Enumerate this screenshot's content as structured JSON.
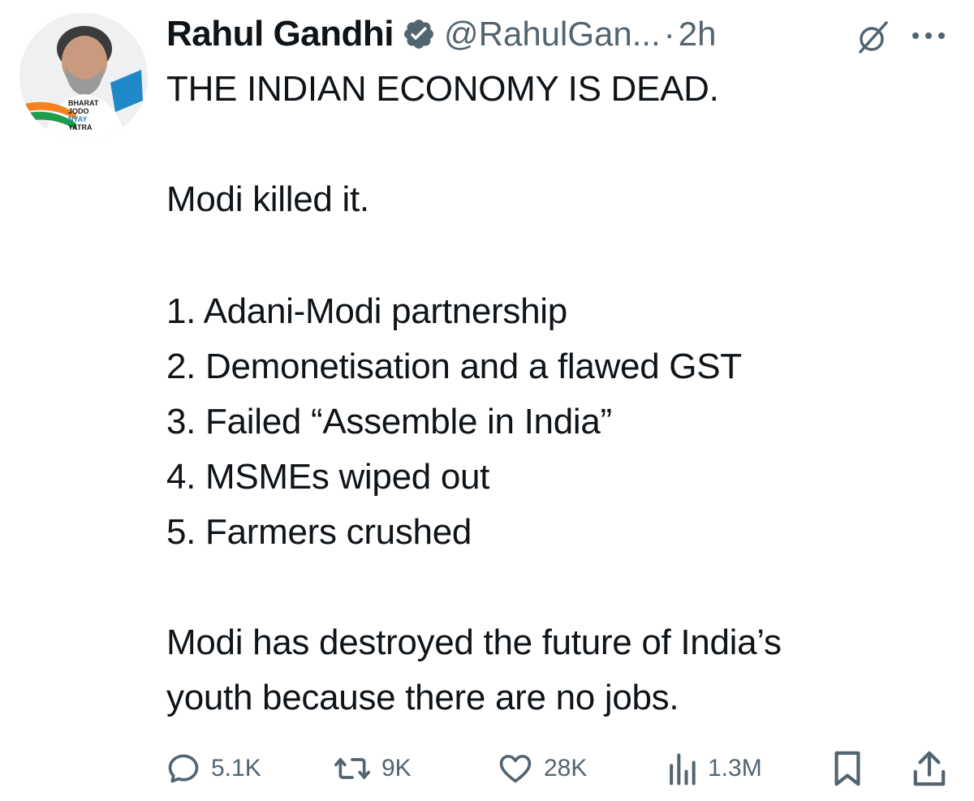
{
  "author": {
    "display_name": "Rahul Gandhi",
    "handle": "@RahulGan...",
    "separator": "·",
    "time": "2h",
    "verified_color": "#536471",
    "avatar_badge_lines": [
      "BHARAT",
      "JODO",
      "NYAY",
      "YATRA"
    ]
  },
  "tweet": {
    "headline": "THE INDIAN ECONOMY IS DEAD.",
    "line2": "Modi killed it.",
    "list": [
      "1. Adani-Modi partnership",
      "2. Demonetisation and a flawed GST",
      "3. Failed “Assemble in India”",
      "4. MSMEs wiped out",
      "5. Farmers crushed"
    ],
    "closing_lines": [
      "Modi has destroyed the future of India’s",
      "youth because there are no jobs."
    ]
  },
  "actions": {
    "replies": "5.1K",
    "reposts": "9K",
    "likes": "28K",
    "views": "1.3M"
  },
  "icons": {
    "verified": "verified-badge-icon",
    "grok": "grok-icon",
    "more": "more-dots-icon",
    "reply": "reply-icon",
    "repost": "repost-icon",
    "like": "heart-icon",
    "views": "views-bar-chart-icon",
    "bookmark": "bookmark-icon",
    "share": "share-icon"
  },
  "colors": {
    "text": "#0f1419",
    "secondary": "#536471",
    "background": "#ffffff"
  }
}
